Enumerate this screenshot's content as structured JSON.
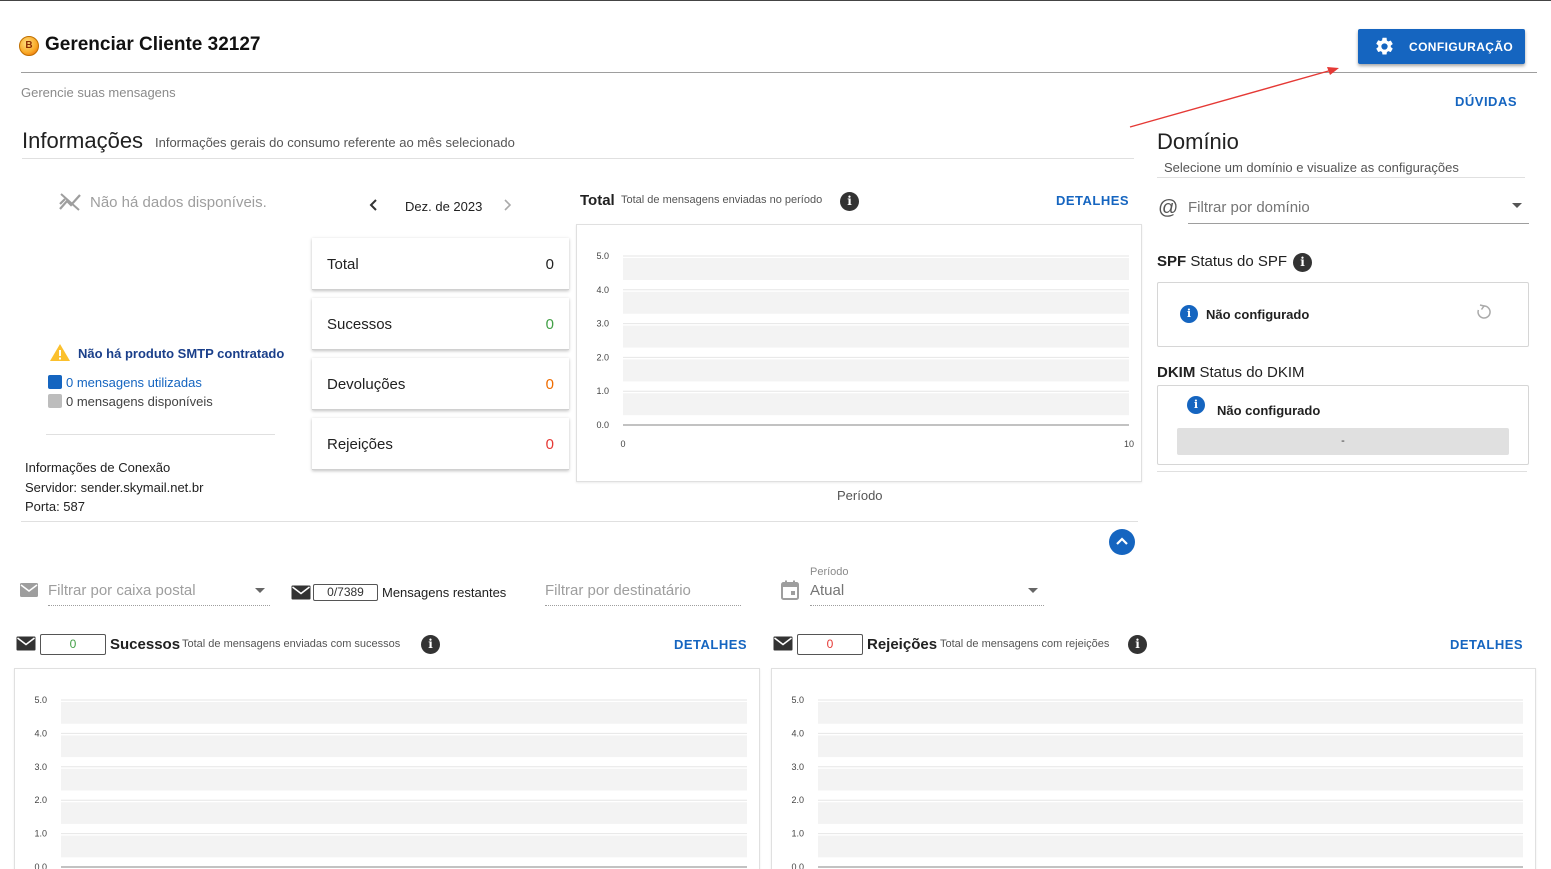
{
  "header": {
    "logo_letter": "B",
    "title": "Gerenciar Cliente 32127",
    "subtitle": "Gerencie suas mensagens",
    "config_label": "CONFIGURAÇÃO",
    "help_label": "DÚVIDAS"
  },
  "info": {
    "heading": "Informações",
    "subheading": "Informações gerais do consumo referente ao mês selecionado",
    "no_data": "Não há dados disponíveis.",
    "no_smtp": "Não há produto SMTP contratado",
    "used": "0 mensagens utilizadas",
    "available": "0 mensagens disponíveis",
    "connection": {
      "title": "Informações de Conexão",
      "server": "Servidor: sender.skymail.net.br",
      "port": "Porta: 587"
    },
    "month": "Dez. de 2023",
    "stats": [
      {
        "label": "Total",
        "value": "0",
        "color": "#212121"
      },
      {
        "label": "Sucessos",
        "value": "0",
        "color": "#43a047"
      },
      {
        "label": "Devoluções",
        "value": "0",
        "color": "#ef6c00"
      },
      {
        "label": "Rejeições",
        "value": "0",
        "color": "#e53935"
      }
    ],
    "total_chart": {
      "title": "Total",
      "subtitle": "Total de mensagens enviadas no período",
      "details": "DETALHES",
      "xlabel": "Período"
    }
  },
  "domain": {
    "heading": "Domínio",
    "subheading": "Selecione um domínio e visualize as configurações",
    "filter_placeholder": "Filtrar por domínio",
    "spf": {
      "code": "SPF",
      "label": "Status do SPF",
      "status": "Não configurado"
    },
    "dkim": {
      "code": "DKIM",
      "label": "Status do DKIM",
      "status": "Não configurado",
      "value": "-"
    }
  },
  "filters": {
    "mailbox_placeholder": "Filtrar por caixa postal",
    "remaining_count": "0/7389",
    "remaining_label": "Mensagens restantes",
    "recipient_placeholder": "Filtrar por destinatário",
    "period_label": "Período",
    "period_value": "Atual"
  },
  "success_chart": {
    "count": "0",
    "title": "Sucessos",
    "subtitle": "Total de mensagens enviadas com sucessos",
    "details": "DETALHES"
  },
  "reject_chart": {
    "count": "0",
    "title": "Rejeições",
    "subtitle": "Total de mensagens com rejeições",
    "details": "DETALHES"
  },
  "chart_data": [
    {
      "type": "bar",
      "x": [
        0,
        10
      ],
      "xlim": [
        0,
        10
      ],
      "values": [],
      "yticks": [
        "0.0",
        "1.0",
        "2.0",
        "3.0",
        "4.0",
        "5.0"
      ],
      "xticks": [
        "0",
        "10"
      ],
      "ylim": [
        0,
        5
      ],
      "title": "Total",
      "xlabel": "Período",
      "grid": true
    },
    {
      "type": "bar",
      "values": [],
      "yticks": [
        "0.0",
        "1.0",
        "2.0",
        "3.0",
        "4.0",
        "5.0"
      ],
      "ylim": [
        0,
        5
      ],
      "title": "Sucessos",
      "grid": true
    },
    {
      "type": "bar",
      "values": [],
      "yticks": [
        "0.0",
        "1.0",
        "2.0",
        "3.0",
        "4.0",
        "5.0"
      ],
      "ylim": [
        0,
        5
      ],
      "title": "Rejeições",
      "grid": true
    }
  ],
  "colors": {
    "primary": "#1565c0",
    "success": "#43a047",
    "warning": "#ef6c00",
    "danger": "#e53935",
    "arrow": "#e53935"
  },
  "icons": {
    "config": "gear-icon",
    "no_data": "trending-icon",
    "warning": "warning-icon",
    "domain": "at-icon",
    "info": "info-icon",
    "refresh": "refresh-icon",
    "mailbox": "mail-icon",
    "envelope": "envelope-icon",
    "calendar": "calendar-icon",
    "collapse": "chevron-up-icon"
  }
}
